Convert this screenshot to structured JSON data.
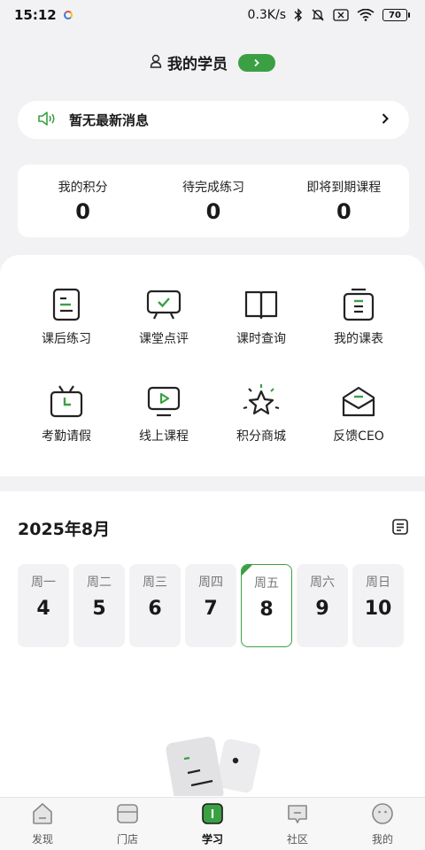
{
  "status_bar": {
    "time": "15:12",
    "network_speed": "0.3K/s",
    "battery": "70"
  },
  "header": {
    "title": "我的学员",
    "pill_icon": "chevron-right-icon",
    "accent_color": "#3aa043"
  },
  "notice": {
    "icon": "speaker-icon",
    "text": "暂无最新消息"
  },
  "stats": [
    {
      "label": "我的积分",
      "value": "0"
    },
    {
      "label": "待完成练习",
      "value": "0"
    },
    {
      "label": "即将到期课程",
      "value": "0"
    }
  ],
  "menu": [
    {
      "label": "课后练习",
      "icon": "exercise-icon"
    },
    {
      "label": "课堂点评",
      "icon": "review-icon"
    },
    {
      "label": "课时查询",
      "icon": "book-icon"
    },
    {
      "label": "我的课表",
      "icon": "schedule-icon"
    },
    {
      "label": "考勤请假",
      "icon": "attendance-icon"
    },
    {
      "label": "线上课程",
      "icon": "video-icon"
    },
    {
      "label": "积分商城",
      "icon": "star-icon"
    },
    {
      "label": "反馈CEO",
      "icon": "mail-icon"
    }
  ],
  "calendar": {
    "month": "2025年8月",
    "days": [
      {
        "name": "周一",
        "num": "4"
      },
      {
        "name": "周二",
        "num": "5"
      },
      {
        "name": "周三",
        "num": "6"
      },
      {
        "name": "周四",
        "num": "7"
      },
      {
        "name": "周五",
        "num": "8",
        "selected": true
      },
      {
        "name": "周六",
        "num": "9"
      },
      {
        "name": "周日",
        "num": "10"
      }
    ]
  },
  "tabbar": [
    {
      "label": "发现",
      "icon": "discover-icon"
    },
    {
      "label": "门店",
      "icon": "store-icon"
    },
    {
      "label": "学习",
      "icon": "study-icon",
      "active": true
    },
    {
      "label": "社区",
      "icon": "community-icon"
    },
    {
      "label": "我的",
      "icon": "profile-icon"
    }
  ]
}
